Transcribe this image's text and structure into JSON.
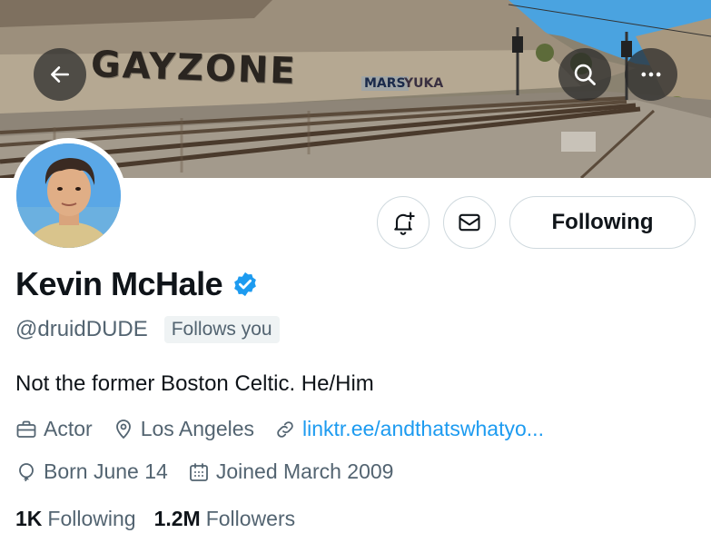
{
  "banner": {
    "graffiti_main": "GAYZONE",
    "graffiti_secondary_1": "MARS",
    "graffiti_secondary_2": "YUKA"
  },
  "header_buttons": {
    "back_icon": "arrow-left-icon",
    "search_icon": "search-icon",
    "more_icon": "more-horizontal-icon"
  },
  "actions": {
    "notify_icon": "bell-plus-icon",
    "message_icon": "envelope-icon",
    "following_label": "Following"
  },
  "profile": {
    "display_name": "Kevin McHale",
    "verified": true,
    "handle": "@druidDUDE",
    "follows_you": "Follows you",
    "bio": "Not the former Boston Celtic. He/Him",
    "profession": "Actor",
    "location": "Los Angeles",
    "website": "linktr.ee/andthatswhatyo...",
    "birthday": "Born June 14",
    "joined": "Joined March 2009"
  },
  "stats": {
    "following_count": "1K",
    "following_label": "Following",
    "followers_count": "1.2M",
    "followers_label": "Followers"
  },
  "colors": {
    "accent": "#1d9bf0",
    "secondary_text": "#536471",
    "primary_text": "#0f1419",
    "border": "#cfd9de"
  }
}
